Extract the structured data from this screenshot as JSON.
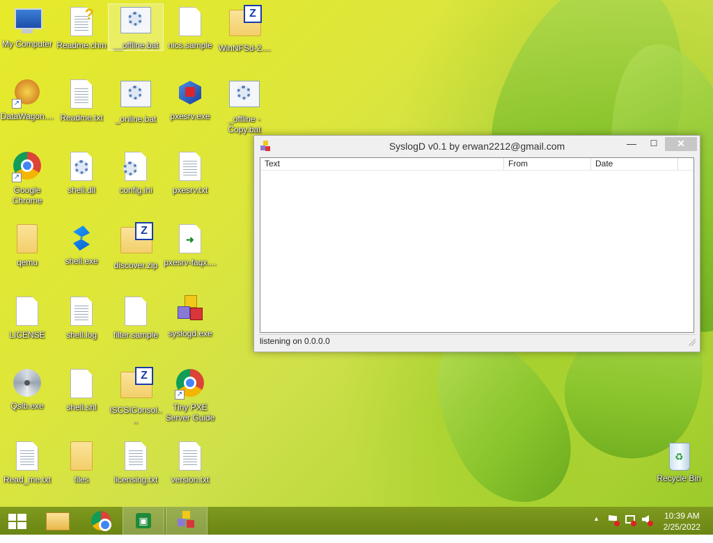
{
  "desktop": {
    "icons": [
      {
        "label": "My Computer"
      },
      {
        "label": "Readme.chm"
      },
      {
        "label": "__offline.bat"
      },
      {
        "label": "nics.sample"
      },
      {
        "label": "WinNFSd-2...."
      },
      {
        "label": "DataWagon...."
      },
      {
        "label": "Readme.txt"
      },
      {
        "label": "_online.bat"
      },
      {
        "label": "pxesrv.exe"
      },
      {
        "label": "_offline - Copy.bat"
      },
      {
        "label": "Google Chrome"
      },
      {
        "label": "shell.dll"
      },
      {
        "label": "config.ini"
      },
      {
        "label": "pxesrv.txt"
      },
      {
        "label": "qemu"
      },
      {
        "label": "shell.exe"
      },
      {
        "label": "discover.zip"
      },
      {
        "label": "pxesrv-faqx...."
      },
      {
        "label": "LICENSE"
      },
      {
        "label": "shell.log"
      },
      {
        "label": "filter.sample"
      },
      {
        "label": "syslogd.exe"
      },
      {
        "label": "Qslb.exe"
      },
      {
        "label": "shell.shl"
      },
      {
        "label": "ISCSIConsol...."
      },
      {
        "label": "Tiny PXE Server Guide"
      },
      {
        "label": "Read_me.txt"
      },
      {
        "label": "files"
      },
      {
        "label": "licensing.txt"
      },
      {
        "label": "version.txt"
      },
      {
        "label": "Recycle Bin"
      }
    ]
  },
  "window": {
    "title": "SyslogD v0.1 by erwan2212@gmail.com",
    "minimize": "—",
    "maximize": "☐",
    "close": "✕",
    "columns": [
      "Text",
      "From",
      "Date"
    ],
    "status": "listening on 0.0.0.0"
  },
  "taskbar": {
    "clock_time": "10:39 AM",
    "clock_date": "2/25/2022",
    "tray_arrow": "▲"
  }
}
